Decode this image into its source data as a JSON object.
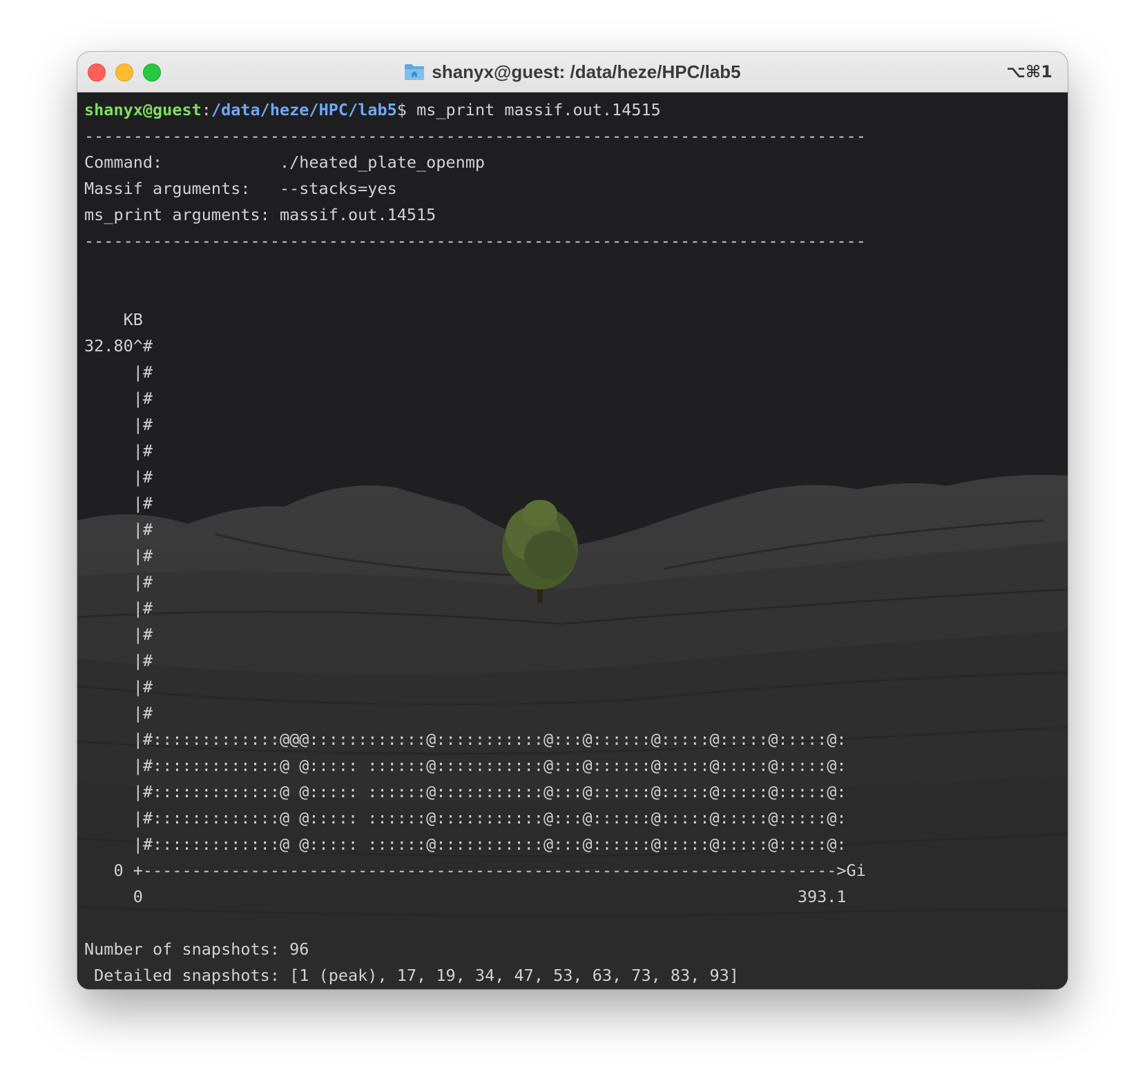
{
  "window": {
    "title": "shanyx@guest: /data/heze/HPC/lab5",
    "shortcut": "⌥⌘1"
  },
  "prompt": {
    "user_host": "shanyx@guest",
    "separator": ":",
    "path": "/data/heze/HPC/lab5",
    "symbol": "$",
    "command": " ms_print massif.out.14515"
  },
  "output": {
    "rule": "--------------------------------------------------------------------------------",
    "header": [
      "Command:            ./heated_plate_openmp",
      "Massif arguments:   --stacks=yes",
      "ms_print arguments: massif.out.14515"
    ],
    "graph": [
      "    KB",
      "32.80^#",
      "     |#",
      "     |#",
      "     |#",
      "     |#",
      "     |#",
      "     |#",
      "     |#",
      "     |#",
      "     |#",
      "     |#",
      "     |#",
      "     |#",
      "     |#",
      "     |#",
      "     |#:::::::::::::@@@::::::::::::@:::::::::::@:::@::::::@:::::@:::::@:::::@:",
      "     |#:::::::::::::@ @::::: ::::::@:::::::::::@:::@::::::@:::::@:::::@:::::@:",
      "     |#:::::::::::::@ @::::: ::::::@:::::::::::@:::@::::::@:::::@:::::@:::::@:",
      "     |#:::::::::::::@ @::::: ::::::@:::::::::::@:::@::::::@:::::@:::::@:::::@:",
      "     |#:::::::::::::@ @::::: ::::::@:::::::::::@:::@::::::@:::::@:::::@:::::@:",
      "   0 +----------------------------------------------------------------------->Gi",
      "     0                                                                   393.1"
    ],
    "summary": [
      "Number of snapshots: 96",
      " Detailed snapshots: [1 (peak), 17, 19, 34, 47, 53, 63, 73, 83, 93]"
    ]
  },
  "colors": {
    "user": "#7ee05c",
    "path": "#6fa8f5",
    "text": "#d2d2d2",
    "background": "#1d1d20"
  }
}
